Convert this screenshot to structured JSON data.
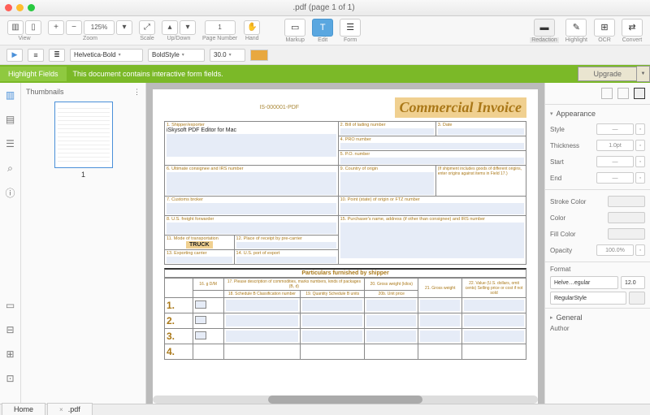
{
  "window": {
    "title": ".pdf (page 1 of 1)"
  },
  "toolbar": {
    "view": "View",
    "zoom": "Zoom",
    "zoom_val": "125%",
    "scale": "Scale",
    "updown": "Up/Down",
    "page_number": "Page Number",
    "page_val": "1",
    "hand": "Hand",
    "markup": "Markup",
    "edit": "Edit",
    "form": "Form",
    "redaction": "Redaction",
    "highlight": "Highlight",
    "ocr": "OCR",
    "convert": "Convert"
  },
  "toolbar2": {
    "font": "Helvetica-Bold",
    "style": "BoldStyle",
    "size": "30.0"
  },
  "banner": {
    "btn": "Highlight Fields",
    "msg": "This document contains interactive form fields.",
    "upgrade": "Upgrade"
  },
  "thumbs": {
    "header": "Thumbnails",
    "num": "1"
  },
  "doc": {
    "id": "IS-000001-PDF",
    "title": "Commercial Invoice",
    "f1": "1. Shipper/exporter",
    "f1v": "iSkysoft PDF Editor for Mac",
    "f2": "2. Bill of lading number",
    "f3": "3. Date",
    "f4": "4. PRO number",
    "f5": "5. P.O. number",
    "f6": "6. Ultimate consignee and IRS number",
    "f9": "9. Country of origin",
    "f9note": "(If shipment includes goods of different origins, enter origins against items in Field 17.)",
    "f7": "7. Customs broker",
    "f10": "10. Point (state) of origin or FTZ number",
    "f8": "8. U.S. freight forwarder",
    "f15": "15. Purchaser's name, address (if other than consignee) and IRS number",
    "f11": "11. Mode of transportation",
    "f11v": "TRUCK",
    "f12": "12. Place of receipt by pre-carrier",
    "f13": "13. Exporting carrier",
    "f14": "14. U.S. port of export",
    "particulars": "Particulars furnished by shipper",
    "pdesc": "17. Please description of commodities, marks numbers, kinds of packages (B, d)",
    "c16": "16. g D/M",
    "c18": "18. Schedule B Classification number",
    "c19": "19. Quantity Schedule B units",
    "c20a": "20. Gross weight (kilos)",
    "c20b": "20b. Unit price",
    "c21": "21. Gross weight",
    "c22": "22. Value (U.S. dollars, omit cents) Selling price or cost if not sold",
    "rows": [
      "1.",
      "2.",
      "3.",
      "4."
    ]
  },
  "panel": {
    "appearance": "Appearance",
    "style": "Style",
    "thickness": "Thickness",
    "thickness_v": "1.0pt",
    "start": "Start",
    "end": "End",
    "stroke": "Stroke Color",
    "color": "Color",
    "fill": "Fill Color",
    "opacity": "Opacity",
    "opacity_v": "100.0%",
    "format": "Format",
    "font": "Helve…egular",
    "size": "12.0",
    "fstyle": "RegularStyle",
    "general": "General",
    "author": "Author"
  },
  "tabs": {
    "home": "Home",
    "doc": ".pdf"
  }
}
